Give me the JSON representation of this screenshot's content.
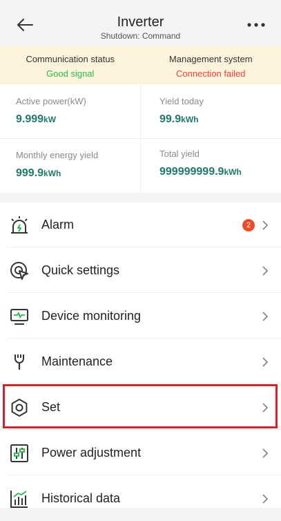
{
  "header": {
    "title": "Inverter",
    "subtitle": "Shutdown: Command",
    "back_icon": "arrow-left-icon",
    "more_icon": "more-dots-icon"
  },
  "status": {
    "communication_label": "Communication status",
    "communication_value": "Good signal",
    "management_label": "Management system",
    "management_value": "Connection failed",
    "good_color": "#2fb84f",
    "bad_color": "#e8453c"
  },
  "kpis": {
    "active_power_label": "Active power(kW)",
    "active_power_value": "9.999",
    "active_power_unit": "kW",
    "yield_today_label": "Yield today",
    "yield_today_value": "99.9",
    "yield_today_unit": "kWh",
    "monthly_label": "Monthly energy yield",
    "monthly_value": "999.9",
    "monthly_unit": "kWh",
    "total_label": "Total yield",
    "total_value": "999999999.9",
    "total_unit": "kWh",
    "value_color": "#1f7a6b"
  },
  "menu": {
    "items": [
      {
        "label": "Alarm",
        "icon": "alarm-light-icon",
        "badge": "2"
      },
      {
        "label": "Quick settings",
        "icon": "quick-settings-icon"
      },
      {
        "label": "Device monitoring",
        "icon": "monitor-icon"
      },
      {
        "label": "Maintenance",
        "icon": "maintenance-icon"
      },
      {
        "label": "Set",
        "icon": "settings-hexagon-icon",
        "highlighted": true
      },
      {
        "label": "Power adjustment",
        "icon": "power-adjustment-icon"
      },
      {
        "label": "Historical data",
        "icon": "historical-data-icon"
      }
    ],
    "highlight_color": "#d8202b"
  }
}
